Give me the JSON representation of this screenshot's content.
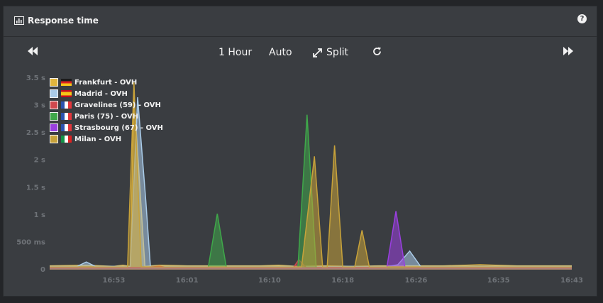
{
  "panel": {
    "title": "Response time",
    "help_icon": "question-circle-icon"
  },
  "toolbar": {
    "range_label": "1 Hour",
    "refresh_label": "Auto",
    "split_label": "Split",
    "icons": {
      "prev": "fast-backward-icon",
      "next": "fast-forward-icon",
      "expand": "expand-arrows-icon",
      "refresh": "refresh-icon"
    }
  },
  "chart_data": {
    "type": "area",
    "title": "Response time",
    "x_ticks": [
      "16:53",
      "16:01",
      "16:10",
      "16:18",
      "16:26",
      "16:35",
      "16:43"
    ],
    "x_tick_minutes": [
      0,
      8,
      17,
      25,
      33,
      42,
      50
    ],
    "xlim_minutes": [
      -7,
      50
    ],
    "y_ticks": [
      "0",
      "500 ms",
      "1 s",
      "1.5 s",
      "2 s",
      "2.5 s",
      "3 s",
      "3.5 s"
    ],
    "y_tick_values": [
      0,
      500,
      1000,
      1500,
      2000,
      2500,
      3000,
      3500
    ],
    "ylim": [
      0,
      3500
    ],
    "unit": "ms",
    "series": [
      {
        "name": "Frankfurt - OVH",
        "flag": "de",
        "color": "#e0b43c",
        "points": [
          [
            -7,
            70
          ],
          [
            -3,
            80
          ],
          [
            0,
            60
          ],
          [
            1,
            80
          ],
          [
            1.8,
            60
          ],
          [
            2.2,
            3200
          ],
          [
            3.4,
            60
          ],
          [
            5,
            80
          ],
          [
            8,
            70
          ],
          [
            12,
            70
          ],
          [
            16,
            70
          ],
          [
            18,
            80
          ],
          [
            20,
            60
          ],
          [
            23,
            70
          ],
          [
            26,
            60
          ],
          [
            29,
            70
          ],
          [
            33,
            70
          ],
          [
            36,
            70
          ],
          [
            40,
            90
          ],
          [
            44,
            70
          ],
          [
            48,
            70
          ],
          [
            50,
            70
          ]
        ]
      },
      {
        "name": "Madrid - OVH",
        "flag": "es",
        "color": "#a9cbe8",
        "points": [
          [
            -7,
            60
          ],
          [
            -4,
            60
          ],
          [
            -3,
            140
          ],
          [
            -2,
            60
          ],
          [
            0,
            60
          ],
          [
            1.8,
            60
          ],
          [
            2.6,
            3150
          ],
          [
            3.5,
            1250
          ],
          [
            4,
            60
          ],
          [
            6,
            60
          ],
          [
            10,
            60
          ],
          [
            14,
            60
          ],
          [
            18,
            60
          ],
          [
            22,
            60
          ],
          [
            26,
            60
          ],
          [
            28.5,
            60
          ],
          [
            30,
            60
          ],
          [
            31,
            90
          ],
          [
            32.3,
            340
          ],
          [
            33.5,
            60
          ],
          [
            36,
            60
          ],
          [
            40,
            60
          ],
          [
            44,
            60
          ],
          [
            50,
            60
          ]
        ]
      },
      {
        "name": "Gravelines (59) - OVH",
        "flag": "fr",
        "color": "#d0484e",
        "points": [
          [
            -7,
            40
          ],
          [
            -2,
            40
          ],
          [
            0,
            40
          ],
          [
            1,
            40
          ],
          [
            3,
            40
          ],
          [
            5,
            60
          ],
          [
            6,
            40
          ],
          [
            10,
            40
          ],
          [
            14,
            40
          ],
          [
            16,
            40
          ],
          [
            18,
            40
          ],
          [
            19.6,
            40
          ],
          [
            20.2,
            180
          ],
          [
            21,
            40
          ],
          [
            24,
            40
          ],
          [
            28,
            40
          ],
          [
            32,
            40
          ],
          [
            36,
            40
          ],
          [
            40,
            40
          ],
          [
            44,
            40
          ],
          [
            48,
            40
          ],
          [
            50,
            40
          ]
        ]
      },
      {
        "name": "Paris (75) - OVH",
        "flag": "fr",
        "color": "#3fa84a",
        "points": [
          [
            -7,
            30
          ],
          [
            0,
            30
          ],
          [
            6,
            30
          ],
          [
            9,
            30
          ],
          [
            10.3,
            30
          ],
          [
            11.3,
            1020
          ],
          [
            12.3,
            30
          ],
          [
            16,
            30
          ],
          [
            19,
            30
          ],
          [
            20.1,
            30
          ],
          [
            21.1,
            2830
          ],
          [
            22.1,
            30
          ],
          [
            24,
            30
          ],
          [
            28,
            30
          ],
          [
            32,
            30
          ],
          [
            36,
            30
          ],
          [
            40,
            30
          ],
          [
            44,
            30
          ],
          [
            48,
            30
          ],
          [
            50,
            30
          ]
        ]
      },
      {
        "name": "Strasbourg (67) - OVH",
        "flag": "fr",
        "color": "#9a3fe0",
        "points": [
          [
            -7,
            30
          ],
          [
            0,
            30
          ],
          [
            8,
            30
          ],
          [
            16,
            30
          ],
          [
            24,
            30
          ],
          [
            28,
            30
          ],
          [
            29.8,
            30
          ],
          [
            30.8,
            1070
          ],
          [
            31.8,
            30
          ],
          [
            34,
            30
          ],
          [
            38,
            30
          ],
          [
            42,
            30
          ],
          [
            46,
            30
          ],
          [
            50,
            30
          ]
        ]
      },
      {
        "name": "Milan - OVH",
        "flag": "it",
        "color": "#c7a23a",
        "points": [
          [
            -7,
            50
          ],
          [
            -2,
            50
          ],
          [
            1.5,
            50
          ],
          [
            2.2,
            3420
          ],
          [
            3.0,
            50
          ],
          [
            6,
            50
          ],
          [
            9,
            50
          ],
          [
            12,
            50
          ],
          [
            16,
            50
          ],
          [
            20.5,
            50
          ],
          [
            21.9,
            2070
          ],
          [
            22.8,
            50
          ],
          [
            23.3,
            50
          ],
          [
            24.1,
            2270
          ],
          [
            25,
            50
          ],
          [
            26.3,
            50
          ],
          [
            27.1,
            720
          ],
          [
            27.9,
            50
          ],
          [
            30,
            50
          ],
          [
            34,
            50
          ],
          [
            38,
            50
          ],
          [
            42,
            50
          ],
          [
            46,
            50
          ],
          [
            50,
            50
          ]
        ]
      }
    ]
  }
}
